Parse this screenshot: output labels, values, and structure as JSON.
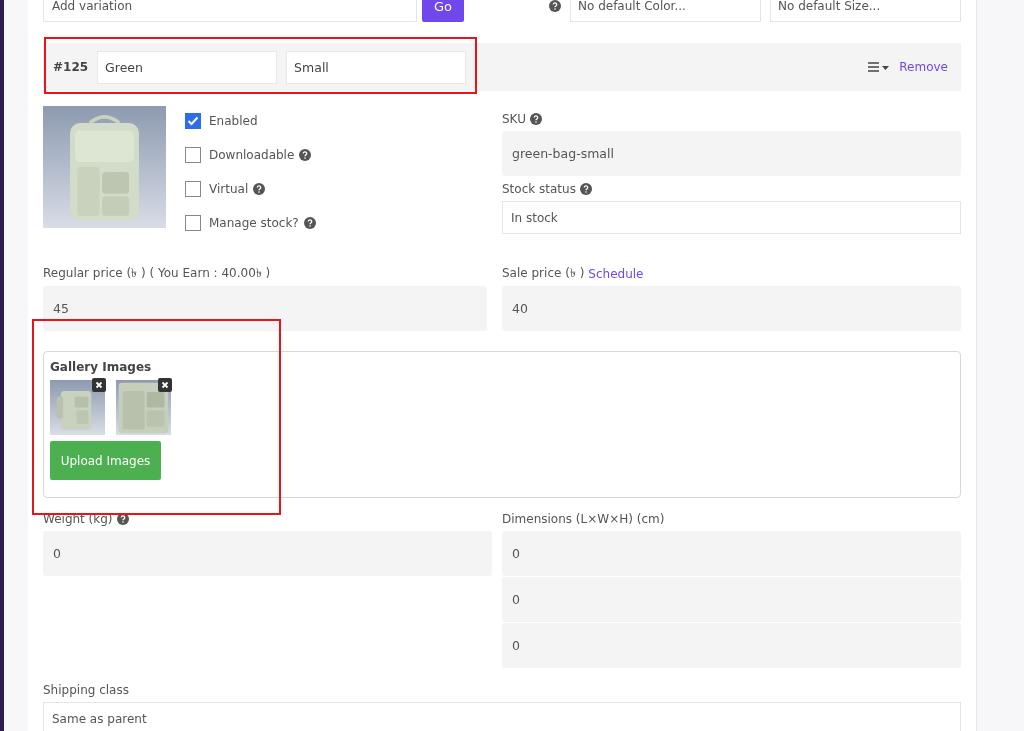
{
  "variation_bar": {
    "placeholder": "Add variation",
    "go_button": "Go",
    "selects": [
      "No default Color...",
      "No default Size..."
    ]
  },
  "variation": {
    "number": "#125",
    "attributes": [
      "Green",
      "Small"
    ],
    "remove_link": "Remove"
  },
  "options": [
    {
      "label": "Enabled",
      "checked": true,
      "help": false
    },
    {
      "label": "Downloadable",
      "checked": false,
      "help": true
    },
    {
      "label": "Virtual",
      "checked": false,
      "help": true
    },
    {
      "label": "Manage stock?",
      "checked": false,
      "help": true
    }
  ],
  "sku": {
    "label": "SKU",
    "value": "green-bag-small"
  },
  "stock_status": {
    "label": "Stock status",
    "value": "In stock"
  },
  "regular_price": {
    "label": "Regular price (৳ ) ( You Earn : 40.00৳  )",
    "value": "45"
  },
  "sale_price": {
    "label": "Sale price (৳ )",
    "link": "Schedule",
    "value": "40"
  },
  "gallery": {
    "title": "Gallery Images",
    "upload_button": "Upload Images"
  },
  "weight": {
    "label": "Weight (kg)",
    "value": "0"
  },
  "dimensions": {
    "label": "Dimensions (L×W×H) (cm)",
    "values": [
      "0",
      "0",
      "0"
    ]
  },
  "shipping_class": {
    "label": "Shipping class",
    "value": "Same as parent"
  }
}
